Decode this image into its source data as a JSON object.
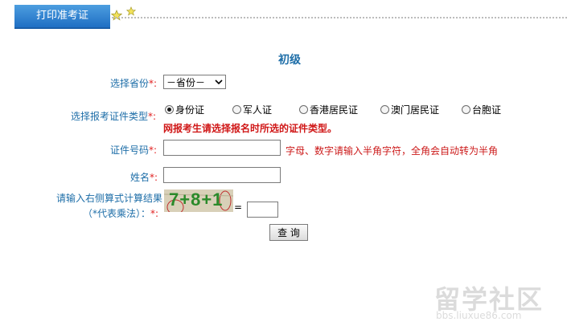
{
  "tab": {
    "label": "打印准考证"
  },
  "page_title": "初级",
  "province": {
    "label": "选择省份",
    "required_mark": "*:",
    "selected": "－省份－"
  },
  "id_type": {
    "label": "选择报考证件类型",
    "required_mark": "*:",
    "options": [
      "身份证",
      "军人证",
      "香港居民证",
      "澳门居民证",
      "台胞证"
    ],
    "selected_index": 0,
    "warning": "网报考生请选择报名时所选的证件类型。"
  },
  "id_number": {
    "label": "证件号码",
    "required_mark": "*:",
    "value": "",
    "hint": "字母、数字请输入半角字符，全角会自动转为半角"
  },
  "name": {
    "label": "姓名",
    "required_mark": "*:",
    "value": ""
  },
  "captcha": {
    "label_line1": "请输入右侧算式计算结果",
    "label_line2": "（*代表乘法）：",
    "required_mark": "*:",
    "expression": "7+8+1",
    "equals": "=",
    "value": ""
  },
  "submit_label": "查 询",
  "watermark": {
    "text": "留学社区",
    "url": "bbs.liuxue86.com"
  },
  "colors": {
    "label": "#1e6ea8",
    "required": "#e02020",
    "warning": "#d01818",
    "tab": "#2b7fd0"
  }
}
